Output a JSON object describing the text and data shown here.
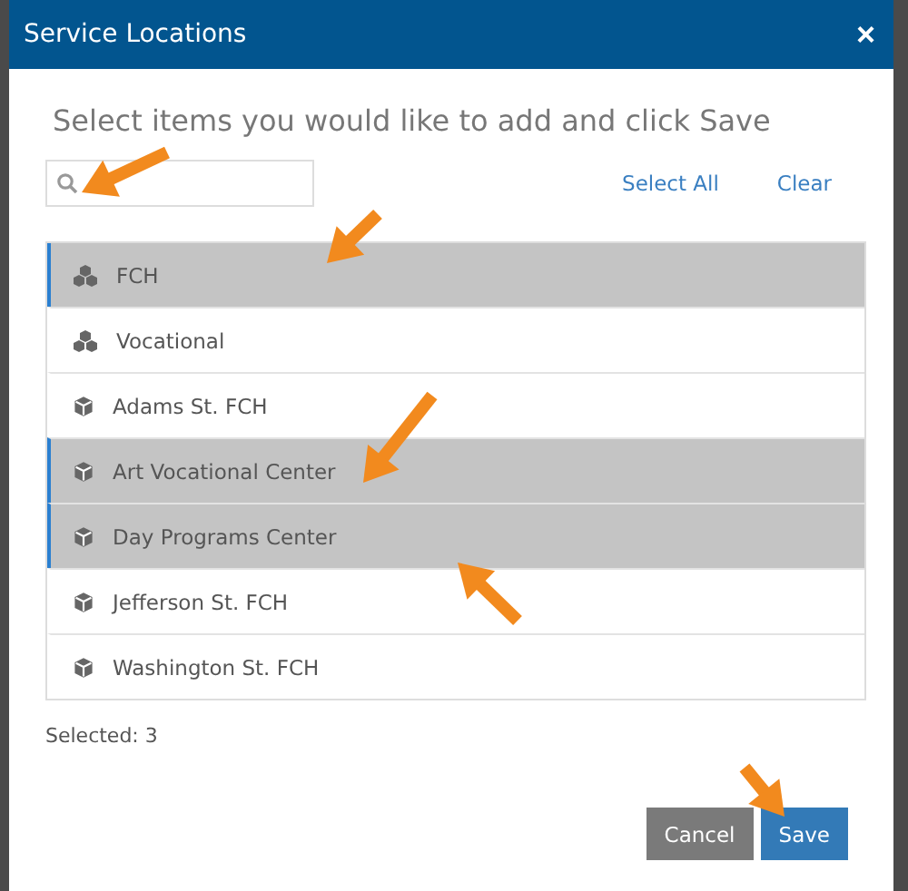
{
  "dialog": {
    "title": "Service Locations",
    "close": "×",
    "instruction": "Select items you would like to add and click Save",
    "links": [
      "Select All",
      "Clear"
    ],
    "items": [
      {
        "label": "FCH",
        "kind": "group",
        "selected": true
      },
      {
        "label": "Vocational",
        "kind": "group",
        "selected": false
      },
      {
        "label": "Adams St. FCH",
        "kind": "single",
        "selected": false
      },
      {
        "label": "Art Vocational Center",
        "kind": "single",
        "selected": true
      },
      {
        "label": "Day Programs Center",
        "kind": "single",
        "selected": true
      },
      {
        "label": "Jefferson St. FCH",
        "kind": "single",
        "selected": false
      },
      {
        "label": "Washington St. FCH",
        "kind": "single",
        "selected": false
      }
    ],
    "selected_count": "Selected: 3",
    "buttons": [
      {
        "label": "Cancel",
        "kind": "secondary"
      },
      {
        "label": "Save",
        "kind": "primary"
      }
    ]
  }
}
